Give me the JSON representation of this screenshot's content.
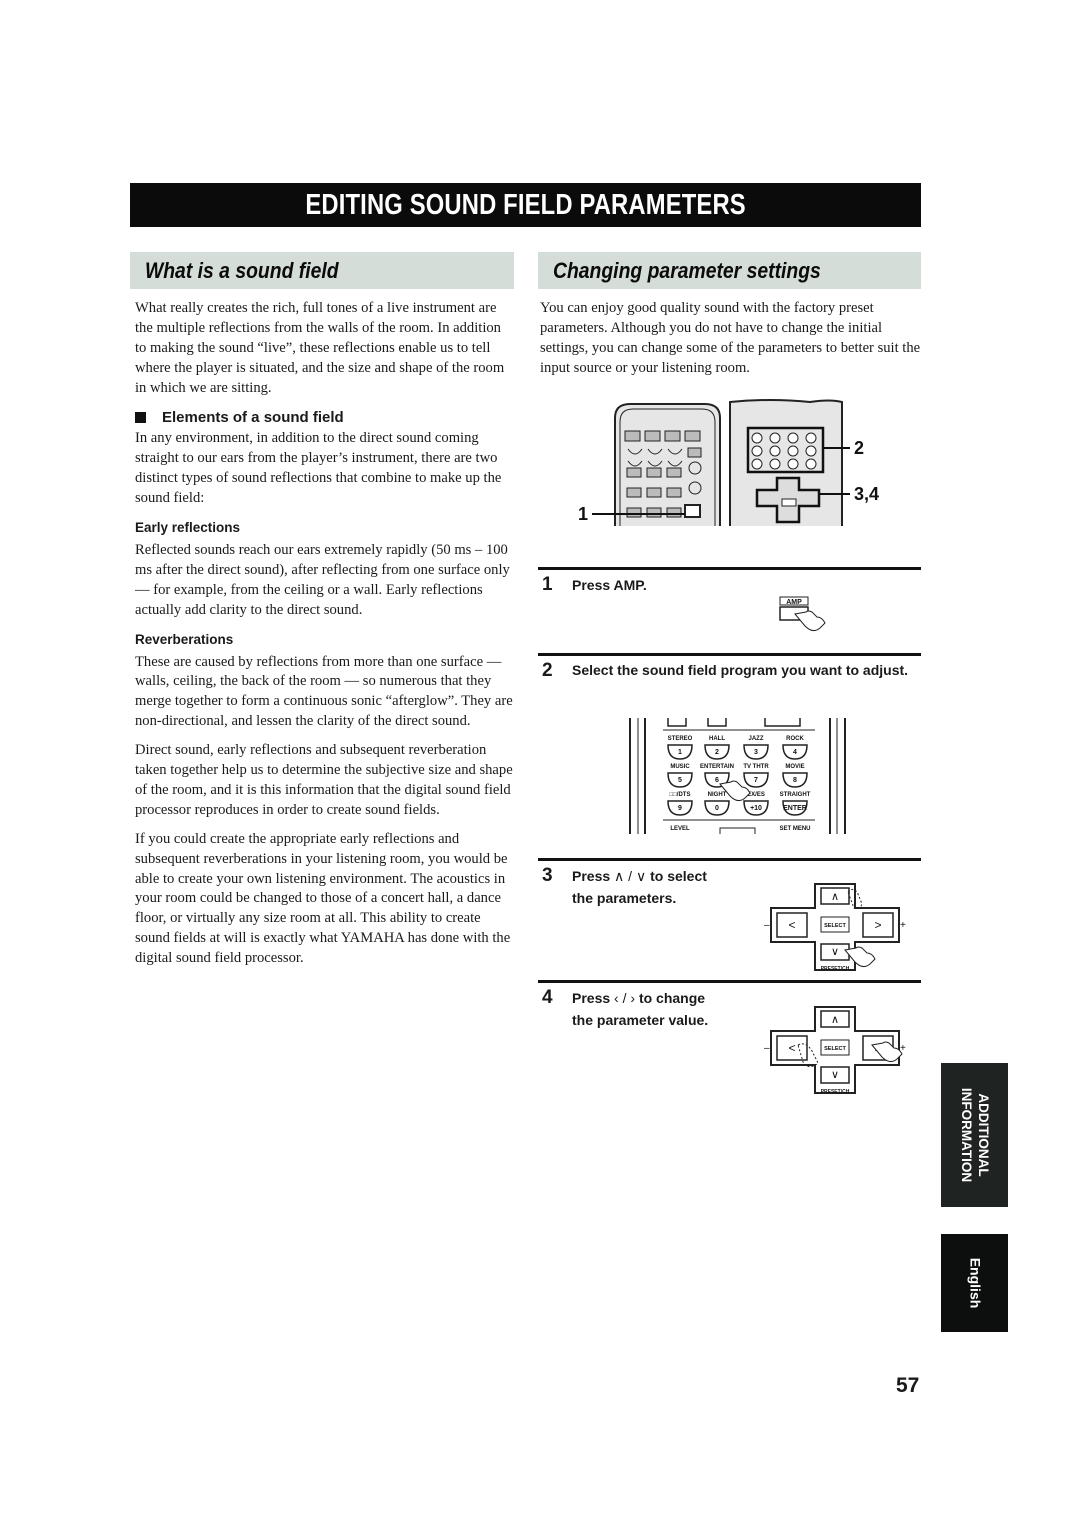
{
  "page": {
    "title": "EDITING SOUND FIELD PARAMETERS",
    "page_number": "57"
  },
  "left": {
    "heading": "What is a sound field",
    "intro": "What really creates the rich, full tones of a live instrument are the multiple reflections from the walls of the room. In addition to making the sound “live”, these reflections enable us to tell where the player is situated, and the size and shape of the room in which we are sitting.",
    "elements_heading": "Elements of a sound field",
    "elements_text": "In any environment, in addition to the direct sound coming straight to our ears from the player’s instrument, there are two distinct types of sound reflections that combine to make up the sound field:",
    "early_heading": "Early reflections",
    "early_text": "Reflected sounds reach our ears extremely rapidly (50 ms – 100 ms after the direct sound), after reflecting from one surface only — for example, from the ceiling or a wall. Early reflections actually add clarity to the direct sound.",
    "reverb_heading": "Reverberations",
    "reverb_text": "These are caused by reflections from more than one surface — walls, ceiling, the back of the room — so numerous that they merge together to form a continuous sonic “afterglow”. They are non-directional, and lessen the clarity of the direct sound.",
    "para_direct": "Direct sound, early reflections and subsequent reverberation taken together help us to determine the subjective size and shape of the room, and it is this information that the digital sound field processor reproduces in order to create sound fields.",
    "para_create": "If you could create the appropriate early reflections and subsequent reverberations in your listening room, you would be able to create your own listening environment. The acoustics in your room could be changed to those of a concert hall, a dance floor, or virtually any size room at all. This ability to create sound fields at will is exactly what YAMAHA has done with the digital sound field processor."
  },
  "right": {
    "heading": "Changing parameter settings",
    "intro": "You can enjoy good quality sound with the factory preset parameters. Although you do not have to change the initial settings, you can change some of the parameters to better suit the input source or your listening room.",
    "callouts": {
      "c1": "1",
      "c2": "2",
      "c34": "3,4"
    },
    "steps": [
      {
        "num": "1",
        "text": "Press AMP."
      },
      {
        "num": "2",
        "text": "Select the sound field program you want to adjust."
      },
      {
        "num": "3",
        "text_a": "Press",
        "sym": "∧ / ∨",
        "text_b": "to select",
        "text_c": "the parameters."
      },
      {
        "num": "4",
        "text_a": "Press",
        "sym": "‹ / ›",
        "text_b": "to change",
        "text_c": "the parameter value."
      }
    ],
    "amp_label": "AMP",
    "keypad": {
      "top_labels": [
        "STEREO",
        "HALL",
        "JAZZ",
        "ROCK"
      ],
      "top_keys": [
        "1",
        "2",
        "3",
        "4"
      ],
      "mid_labels": [
        "MUSIC",
        "ENTERTAIN",
        "TV THTR",
        "MOVIE"
      ],
      "mid_keys": [
        "5",
        "6",
        "7",
        "8"
      ],
      "bot_labels": [
        "□□/DTS",
        "NIGHT",
        "EX/ES",
        "STRAIGHT"
      ],
      "bot_keys": [
        "9",
        "0",
        "+10",
        "ENTER"
      ],
      "footer_left": "LEVEL",
      "footer_right": "SET MENU"
    },
    "dpad": {
      "select": "SELECT",
      "preset": "PRESET/CH",
      "minus": "–",
      "plus": "+"
    }
  },
  "side_tabs": {
    "section": [
      "ADDITIONAL",
      "INFORMATION"
    ],
    "language": "English"
  }
}
